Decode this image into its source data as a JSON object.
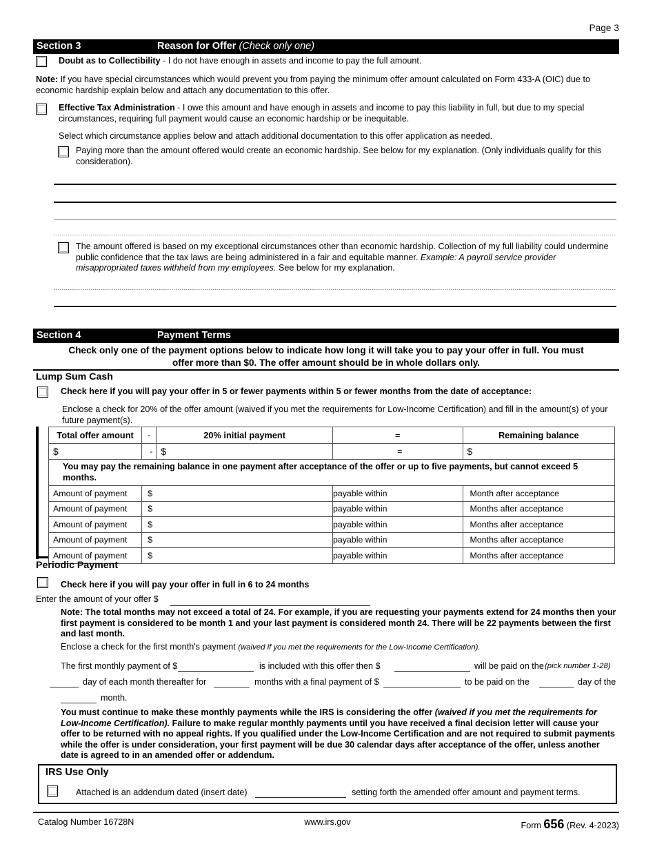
{
  "page": {
    "page_label": "Page 3"
  },
  "section3": {
    "bar": {
      "number": "Section 3",
      "title": "Reason for Offer",
      "hint": "(Check only one)"
    },
    "doubt": {
      "label": "Doubt as to Collectibility",
      "text": " - I do not have enough in assets and income to pay the full amount."
    },
    "note": {
      "label": "Note:",
      "text": " If you have special circumstances which would prevent you from paying the minimum offer amount calculated on Form 433-A (OIC) due to economic hardship explain below and attach any documentation to this offer."
    },
    "eta": {
      "label": "Effective Tax Administration",
      "text": " - I owe this amount and have enough in assets and income to pay this liability in full, but due to my special circumstances, requiring full payment would cause an economic hardship or be inequitable."
    },
    "select_line": "Select which circumstance applies below and attach additional documentation to this offer application as needed.",
    "option_hardship": "Paying more than the amount offered would create an economic hardship. See below for my explanation. (Only individuals qualify for this consideration).",
    "option_exceptional_a": "The amount offered is based on my exceptional circumstances other than economic hardship. Collection of my full liability could undermine public confidence that the tax laws are being administered in a fair and equitable manner. ",
    "option_exceptional_example": "Example: A payroll service provider misappropriated taxes withheld from my employees.",
    "option_exceptional_b": " See below for my explanation."
  },
  "section4": {
    "bar": {
      "number": "Section 4",
      "title": "Payment Terms",
      "hint": ""
    },
    "intro_line1": "Check only one of the payment options below to indicate how long it will take you to pay your offer in full. You must",
    "intro_line2": "offer more than $0. The offer amount should be in whole dollars only.",
    "lump_sum": {
      "heading": "Lump Sum Cash",
      "check_text": "Check here if you will pay your offer in 5 or fewer payments within 5 or fewer months from the date of acceptance:",
      "enclose_text": "Enclose a check for 20% of the offer amount (waived if you met the requirements for Low-Income Certification) and fill in the amount(s) of your future payment(s).",
      "table": {
        "headers": [
          "Total offer amount",
          "-",
          "20% initial payment",
          "=",
          "Remaining balance"
        ],
        "value_row": [
          "$",
          "-",
          "$",
          "=",
          "$"
        ],
        "note": "You may pay the remaining balance in one payment after acceptance of the offer or up to five payments, but cannot exceed 5 months.",
        "rows": [
          {
            "label": "Amount of payment",
            "dollar": "$",
            "within": "payable within",
            "month": "Month after acceptance"
          },
          {
            "label": "Amount of payment",
            "dollar": "$",
            "within": "payable within",
            "month": "Months after acceptance"
          },
          {
            "label": "Amount of payment",
            "dollar": "$",
            "within": "payable within",
            "month": "Months after acceptance"
          },
          {
            "label": "Amount of payment",
            "dollar": "$",
            "within": "payable within",
            "month": "Months after acceptance"
          },
          {
            "label": "Amount of payment",
            "dollar": "$",
            "within": "payable within",
            "month": "Months after acceptance"
          }
        ]
      }
    },
    "periodic": {
      "heading": "Periodic Payment",
      "check_text": "Check here if you will pay your offer in full in 6 to 24 months",
      "enter_amount_label": "Enter the amount of your offer $",
      "enter_amount_value": "",
      "note": "Note: The total months may not exceed a total of 24. For example, if you are requesting your payments extend for 24 months then your first payment is considered to be month 1 and your last payment is considered month 24. There will be 22 payments between the first and last month.",
      "enclose_plain": "Enclose a check for the first month's payment ",
      "enclose_italic": "(waived if you met the requirements for the Low-Income Certification).",
      "schedule": {
        "p1": "The first monthly payment of $",
        "v1": "",
        "p2": "is included with this offer then $",
        "v2": "",
        "p3": "will be paid on the",
        "hint": "(pick number 1-28)",
        "v3": "",
        "p4": "day of each month thereafter for",
        "v4": "",
        "p5": "months with a final payment of $",
        "v5": "",
        "p6": "to be paid on the",
        "v6": "",
        "p7": "day of the",
        "v7": "",
        "p8": "month."
      },
      "warning_a": "You must continue to make these monthly payments while the IRS is considering the offer ",
      "warning_italic": "(waived if you met the requirements for Low-Income Certification).",
      "warning_b": " Failure to make regular monthly payments until you have received a final decision letter will cause your offer to be returned with no appeal rights. If you qualified under the Low-Income Certification and are not required to submit payments while the offer is under consideration, your first payment will be due 30 calendar days after acceptance of the offer, unless another date is agreed to in an amended offer or addendum."
    }
  },
  "irs_use_only": {
    "heading": "IRS Use Only",
    "addendum_prefix": "Attached is an addendum dated (insert date)",
    "addendum_date_value": "",
    "addendum_suffix": "setting forth the amended offer amount and payment terms."
  },
  "footer": {
    "catalog": "Catalog Number 16728N",
    "website": "www.irs.gov",
    "form_prefix": "Form ",
    "form_number": "656",
    "form_rev": " (Rev. 4-2023)"
  }
}
